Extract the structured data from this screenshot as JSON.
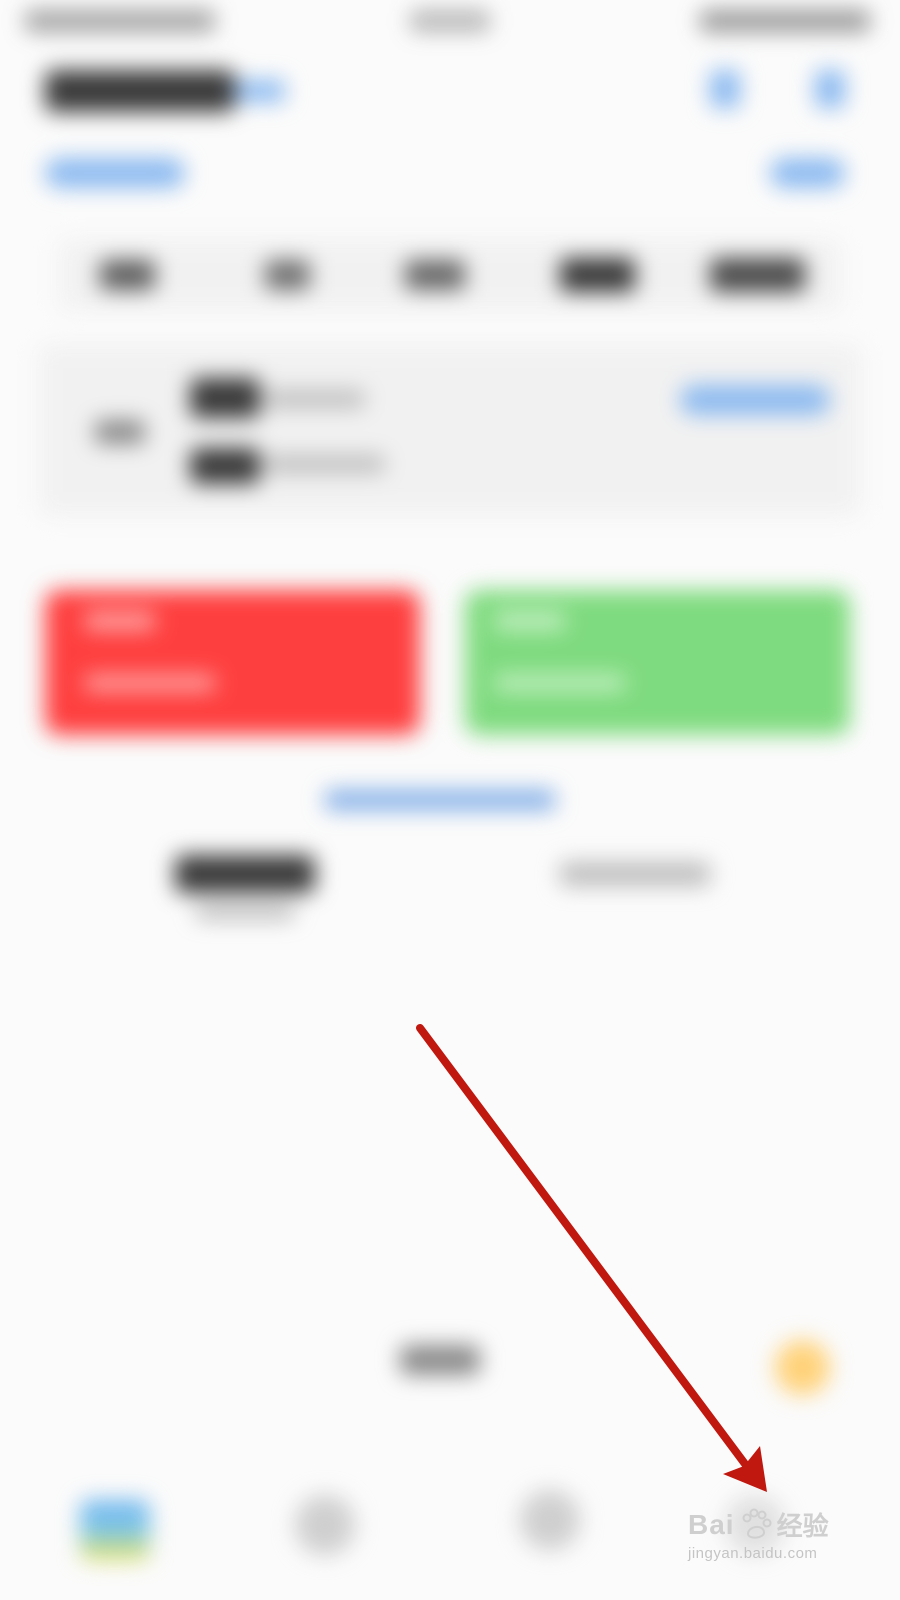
{
  "screen": {
    "state": "blurred",
    "colors": {
      "background": "#fbfbfb",
      "buy_card": "#fe3f3f",
      "sell_card": "#7fdb7f",
      "accent_blue": "#5a94e0",
      "arrow": "#c0170f"
    }
  },
  "annotation": {
    "icon": "arrow-down-right",
    "color": "#c0170f"
  },
  "watermark": {
    "brand_prefix": "Bai",
    "brand_suffix": "经验",
    "url": "jingyan.baidu.com"
  }
}
